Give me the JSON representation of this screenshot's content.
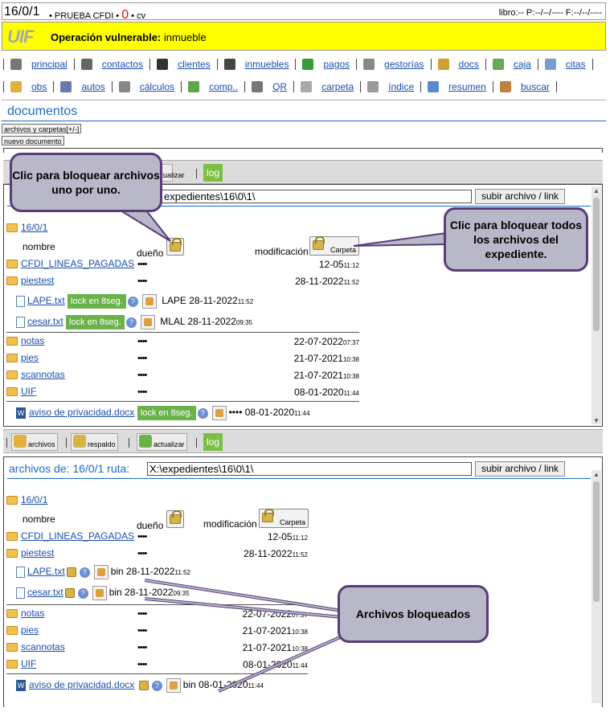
{
  "topbar": {
    "case": "16/0/1",
    "mid": " • PRUEBA CFDI • ",
    "zero": "0",
    "after": " • cv",
    "libro": "libro:-- P:--/--/---- F:--/--/----"
  },
  "alert": {
    "logo": "UIF",
    "label": "Operación vulnerable:",
    "value": " inmueble"
  },
  "nav_row1": [
    {
      "label": "principal",
      "icon": "home-icon",
      "color": "#777"
    },
    {
      "label": "contactos",
      "icon": "phone-icon",
      "color": "#666"
    },
    {
      "label": "clientes",
      "icon": "users-icon",
      "color": "#333"
    },
    {
      "label": "inmuebles",
      "icon": "globe-icon",
      "color": "#444"
    },
    {
      "label": "pagos",
      "icon": "dollar-icon",
      "color": "#3a9a3a"
    },
    {
      "label": "gestorías",
      "icon": "notebook-icon",
      "color": "#888"
    },
    {
      "label": "docs",
      "icon": "document-icon",
      "color": "#d0a030"
    },
    {
      "label": "caja",
      "icon": "cash-icon",
      "color": "#6aa85a"
    },
    {
      "label": "citas",
      "icon": "calendar-icon",
      "color": "#7a9ad0"
    }
  ],
  "nav_row2": [
    {
      "label": "obs",
      "icon": "folder-icon",
      "color": "#e0b040"
    },
    {
      "label": "autos",
      "icon": "car-icon",
      "color": "#6a7ab0"
    },
    {
      "label": "cálculos",
      "icon": "calculator-icon",
      "color": "#888"
    },
    {
      "label": "comp..",
      "icon": "puzzle-icon",
      "color": "#5aa84a"
    },
    {
      "label": "QR",
      "icon": "qr-icon",
      "color": "#777"
    },
    {
      "label": "carpeta",
      "icon": "briefcase-icon",
      "color": "#aaa"
    },
    {
      "label": "índice",
      "icon": "index-icon",
      "color": "#999"
    },
    {
      "label": "resumen",
      "icon": "monitor-icon",
      "color": "#5a8ad0"
    },
    {
      "label": "buscar",
      "icon": "magnifier-icon",
      "color": "#c08040"
    }
  ],
  "section_title": "documentos",
  "btn_toggle": "archivos y carpetas[+/-]",
  "btn_new": "nuevo documento",
  "toolbar": {
    "archivos": "archivos",
    "respaldo": "respaldo",
    "actualizar": "actualizar",
    "log": "log"
  },
  "panel1": {
    "path": "X:\\expedientes\\16\\0\\1\\",
    "path_visible": "expedientes\\16\\0\\1\\",
    "upload": "subir archivo / link"
  },
  "panel2": {
    "title": "archivos de: 16/0/1 ruta:",
    "path": "X:\\expedientes\\16\\0\\1\\",
    "upload": "subir archivo / link"
  },
  "tree": {
    "root": "16/0/1",
    "col_nombre": "nombre",
    "col_dueno": "dueño",
    "col_modificacion": "modificación",
    "carpeta": "Carpeta",
    "dots": "••••"
  },
  "folders": [
    {
      "name": "CFDI_LINEAS_PAGADAS",
      "date": "12-05",
      "time": "11:12"
    },
    {
      "name": "piestest",
      "date": "28-11-2022",
      "time": "11:52"
    }
  ],
  "files1": [
    {
      "name": "LAPE.txt",
      "owner": "LAPE",
      "date": "28-11-2022",
      "time": "11:52"
    },
    {
      "name": "cesar.txt",
      "owner": "MLAL",
      "date": "28-11-2022",
      "time": "09:35"
    }
  ],
  "folders_b": [
    {
      "name": "notas",
      "date": "22-07-2022",
      "time": "07:37"
    },
    {
      "name": "pies",
      "date": "21-07-2021",
      "time": "10:38"
    },
    {
      "name": "scannotas",
      "date": "21-07-2021",
      "time": "10:38"
    },
    {
      "name": "UIF",
      "date": "08-01-2020",
      "time": "11:44"
    }
  ],
  "docx": {
    "name": "aviso de privacidad.docx",
    "date": "08-01-2020",
    "time": "11:44",
    "bin": "bin"
  },
  "lock_label": "lock en 8seg.",
  "bin": "bin",
  "callouts": {
    "one": "Clic para bloquear archivos uno por uno.",
    "all": "Clic para bloquear todos los archivos del expediente.",
    "locked": "Archivos bloqueados"
  }
}
